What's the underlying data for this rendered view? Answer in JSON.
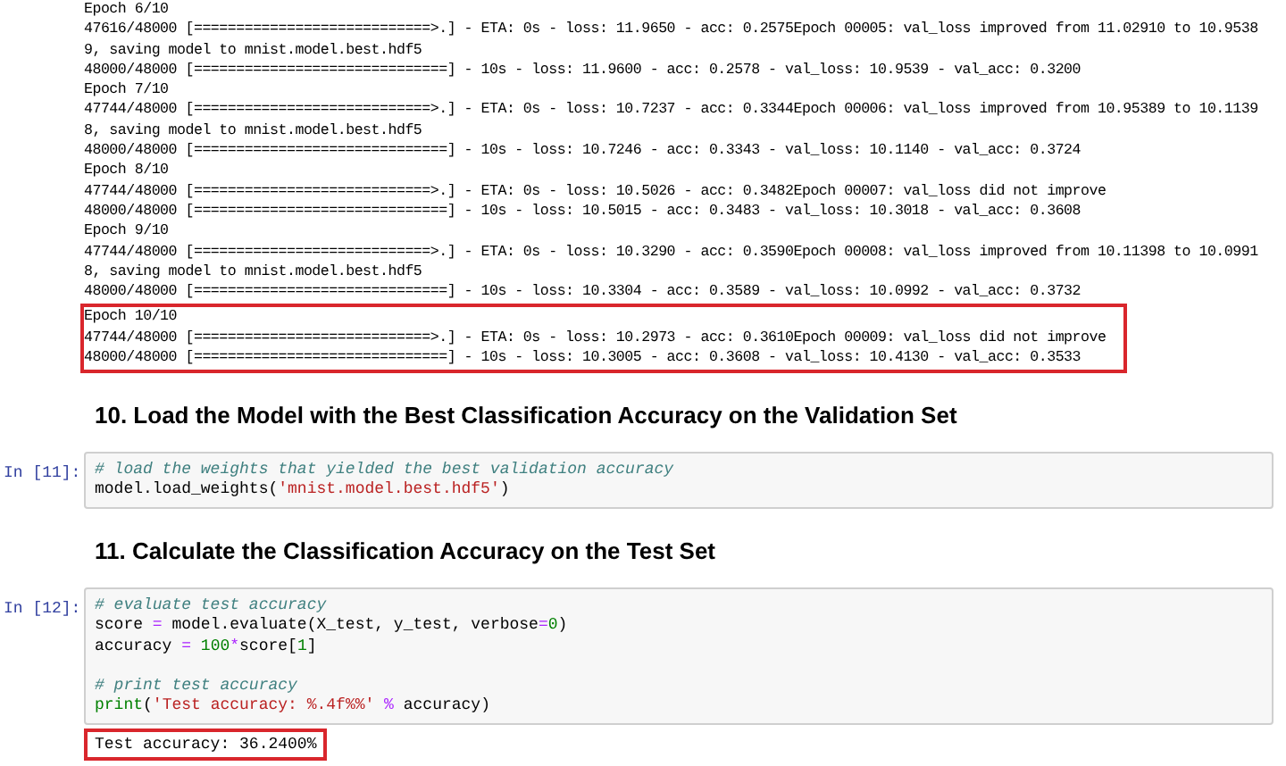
{
  "training_output": [
    {
      "highlighted": false,
      "lines": [
        "Epoch 6/10",
        "47616/48000 [============================>.] - ETA: 0s - loss: 11.9650 - acc: 0.2575Epoch 00005: val_loss improved from 11.02910 to 10.9538",
        "9, saving model to mnist.model.best.hdf5",
        "48000/48000 [==============================] - 10s - loss: 11.9600 - acc: 0.2578 - val_loss: 10.9539 - val_acc: 0.3200",
        "Epoch 7/10",
        "47744/48000 [============================>.] - ETA: 0s - loss: 10.7237 - acc: 0.3344Epoch 00006: val_loss improved from 10.95389 to 10.1139",
        "8, saving model to mnist.model.best.hdf5",
        "48000/48000 [==============================] - 10s - loss: 10.7246 - acc: 0.3343 - val_loss: 10.1140 - val_acc: 0.3724",
        "Epoch 8/10",
        "47744/48000 [============================>.] - ETA: 0s - loss: 10.5026 - acc: 0.3482Epoch 00007: val_loss did not improve",
        "48000/48000 [==============================] - 10s - loss: 10.5015 - acc: 0.3483 - val_loss: 10.3018 - val_acc: 0.3608",
        "Epoch 9/10",
        "47744/48000 [============================>.] - ETA: 0s - loss: 10.3290 - acc: 0.3590Epoch 00008: val_loss improved from 10.11398 to 10.0991",
        "8, saving model to mnist.model.best.hdf5",
        "48000/48000 [==============================] - 10s - loss: 10.3304 - acc: 0.3589 - val_loss: 10.0992 - val_acc: 0.3732"
      ]
    },
    {
      "highlighted": true,
      "lines": [
        "Epoch 10/10",
        "47744/48000 [============================>.] - ETA: 0s - loss: 10.2973 - acc: 0.3610Epoch 00009: val_loss did not improve",
        "48000/48000 [==============================] - 10s - loss: 10.3005 - acc: 0.3608 - val_loss: 10.4130 - val_acc: 0.3533"
      ]
    }
  ],
  "sections": [
    {
      "heading": "10. Load the Model with the Best Classification Accuracy on the Validation Set",
      "cell": {
        "prompt": "In [11]:",
        "code": [
          [
            [
              {
                "kind": "comment",
                "text": "# load the weights that yielded the best validation accuracy"
              }
            ],
            [
              {
                "kind": "plain",
                "text": "model.load_weights("
              },
              {
                "kind": "string",
                "text": "'mnist.model.best.hdf5'"
              },
              {
                "kind": "plain",
                "text": ")"
              }
            ]
          ]
        ]
      }
    },
    {
      "heading": "11. Calculate the Classification Accuracy on the Test Set",
      "cell": {
        "prompt": "In [12]:",
        "code": [
          [
            [
              {
                "kind": "comment",
                "text": "# evaluate test accuracy"
              }
            ],
            [
              {
                "kind": "plain",
                "text": "score "
              },
              {
                "kind": "operator",
                "text": "="
              },
              {
                "kind": "plain",
                "text": " model.evaluate(X_test, y_test, verbose"
              },
              {
                "kind": "operator",
                "text": "="
              },
              {
                "kind": "number",
                "text": "0"
              },
              {
                "kind": "plain",
                "text": ")"
              }
            ],
            [
              {
                "kind": "plain",
                "text": "accuracy "
              },
              {
                "kind": "operator",
                "text": "="
              },
              {
                "kind": "number",
                "text": " 100"
              },
              {
                "kind": "operator",
                "text": "*"
              },
              {
                "kind": "plain",
                "text": "score["
              },
              {
                "kind": "number",
                "text": "1"
              },
              {
                "kind": "plain",
                "text": "]"
              }
            ]
          ],
          [
            [
              {
                "kind": "comment",
                "text": "# print test accuracy"
              }
            ],
            [
              {
                "kind": "builtin",
                "text": "print"
              },
              {
                "kind": "plain",
                "text": "("
              },
              {
                "kind": "string",
                "text": "'Test accuracy: %.4f%%'"
              },
              {
                "kind": "operator",
                "text": " %"
              },
              {
                "kind": "plain",
                "text": " accuracy)"
              }
            ]
          ]
        ],
        "output": {
          "text": "Test accuracy: 36.2400%",
          "highlighted": true
        }
      }
    }
  ]
}
